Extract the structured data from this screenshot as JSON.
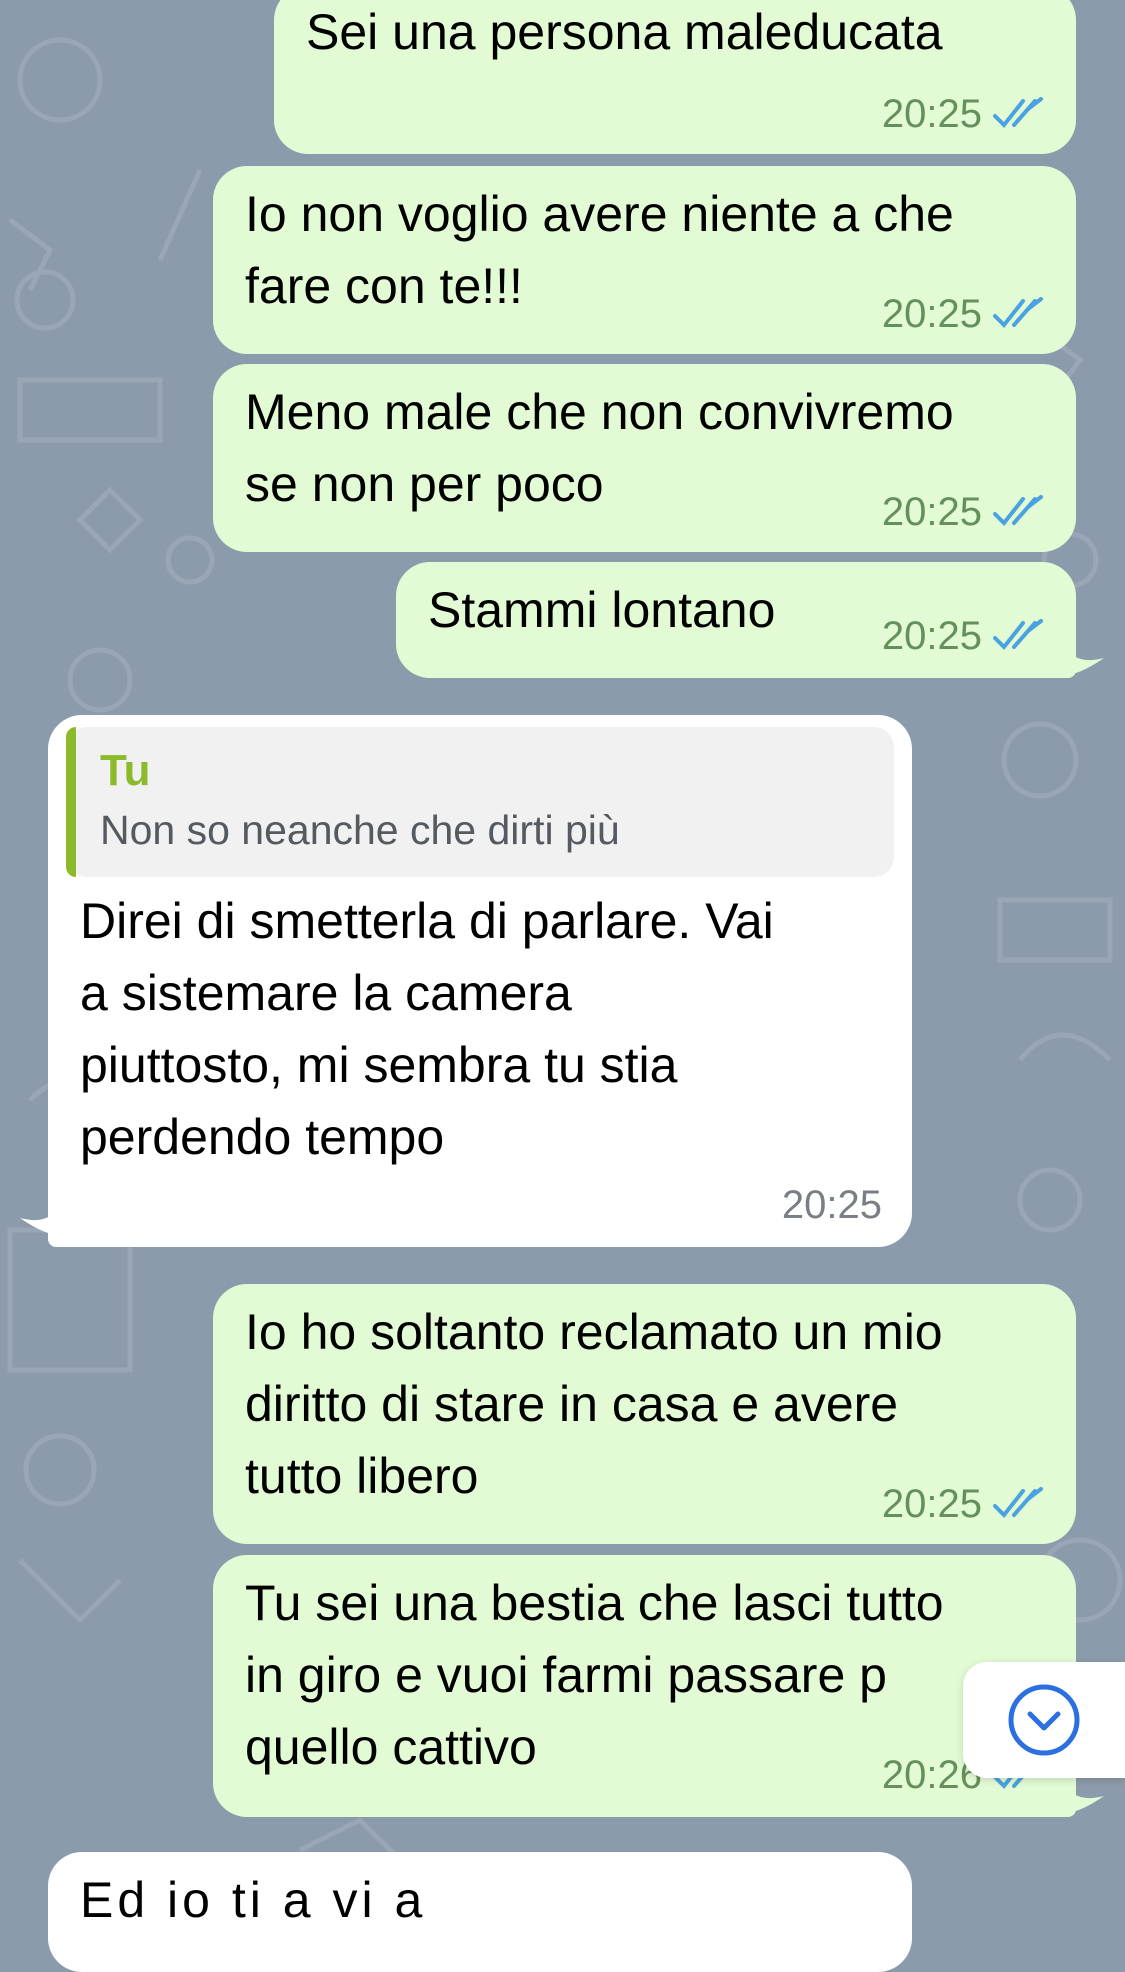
{
  "chat": {
    "messages": [
      {
        "text": "Sei una persona maleducata",
        "time": "20:25",
        "direction": "outgoing",
        "status": "read"
      },
      {
        "text": "Io non voglio avere niente a che\nfare con te!!!",
        "time": "20:25",
        "direction": "outgoing",
        "status": "read"
      },
      {
        "text": "Meno male che non convivremo\nse non per poco",
        "time": "20:25",
        "direction": "outgoing",
        "status": "read"
      },
      {
        "text": "Stammi lontano",
        "time": "20:25",
        "direction": "outgoing",
        "status": "read"
      },
      {
        "reply_to": {
          "name": "Tu",
          "text": "Non so neanche che dirti più"
        },
        "text": "Direi di smetterla di parlare. Vai\na sistemare la camera\npiuttosto, mi sembra tu stia\nperdendo tempo",
        "time": "20:25",
        "direction": "incoming"
      },
      {
        "text": "Io ho soltanto reclamato un mio\ndiritto di stare in casa e avere\ntutto libero",
        "time": "20:25",
        "direction": "outgoing",
        "status": "read"
      },
      {
        "text": "Tu sei una bestia che lasci tutto\nin giro e vuoi farmi passare p\nquello cattivo",
        "time": "20:26",
        "direction": "outgoing",
        "status": "read"
      },
      {
        "text": "Ed io ti a vi a",
        "direction": "incoming"
      }
    ]
  },
  "colors": {
    "outgoing_bubble": "#e2fbd4",
    "incoming_bubble": "#ffffff",
    "read_ticks": "#4aa3e0",
    "reply_accent": "#8bbb2a",
    "background": "#8c9bab"
  },
  "icons": {
    "read_receipt": "double-check-icon",
    "scroll_down": "chevron-down-circle-icon"
  }
}
